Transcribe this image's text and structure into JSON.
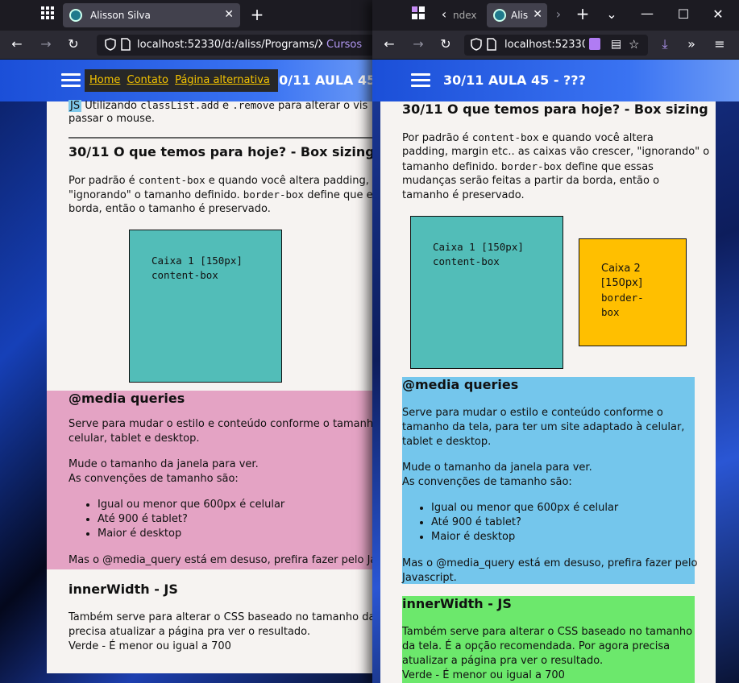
{
  "left": {
    "tab_title": "Alisson Silva",
    "url": "localhost:52330/d:/aliss/Programs/X",
    "url_extra": "Cursos",
    "nav": [
      "Home",
      "Contato",
      "Página alternativa"
    ],
    "header_title": "30/11 AULA 45 -",
    "intro_badge": "JS",
    "intro_text_a": "Utilizando",
    "intro_code_a": "classList.add",
    "intro_text_b": "e",
    "intro_code_b": ".remove",
    "intro_text_c": "para alterar o vis",
    "intro_line2": "passar o mouse.",
    "box_title": "30/11 O que temos para hoje? - Box sizing",
    "box_p1_a": "Por padrão é",
    "box_p1_code": "content-box",
    "box_p1_b": "e quando você altera padding, n",
    "box_p2_a": "\"ignorando\" o tamanho definido.",
    "box_p2_code": "border-box",
    "box_p2_b": "define que es",
    "box_p3": "borda, então o tamanho é preservado.",
    "caixa1_label": "Caixa 1 [150px]",
    "caixa1_code": "content-box",
    "media_title": "@media queries",
    "media_p1a": "Serve para mudar o estilo e conteúdo conforme o tamanho d",
    "media_p1b": "celular, tablet e desktop.",
    "media_p2": "Mude o tamanho da janela para ver.",
    "media_p3": "As convenções de tamanho são:",
    "media_list": [
      "Igual ou menor que 600px é celular",
      "Até 900 é tablet?",
      "Maior é desktop"
    ],
    "media_p4": "Mas o @media_query está em desuso, prefira fazer pelo Java",
    "inner_title": "innerWidth - JS",
    "inner_p1": "Também serve para alterar o CSS baseado no tamanho da te",
    "inner_p2": "precisa atualizar a página pra ver o resultado.",
    "inner_p3": "Verde - É menor ou igual a 700"
  },
  "right": {
    "tab_title_1": "ndex",
    "tab_title_2": "Alis",
    "url": "localhost:52330",
    "header_title": "30/11 AULA 45 - ???",
    "box_title": "30/11 O que temos para hoje? - Box sizing",
    "box_p1_a": "Por padrão é",
    "box_p1_code": "content-box",
    "box_p1_b": "e quando você altera",
    "box_p2": "padding, margin etc.. as caixas vão crescer, \"ignorando\" o",
    "box_p3_a": "tamanho definido.",
    "box_p3_code": "border-box",
    "box_p3_b": "define que essas",
    "box_p4": "mudanças serão feitas a partir da borda, então o",
    "box_p5": "tamanho é preservado.",
    "caixa1_label": "Caixa 1 [150px]",
    "caixa1_code": "content-box",
    "caixa2_label_a": "Caixa 2",
    "caixa2_label_b": "[150px]",
    "caixa2_code_a": "border-",
    "caixa2_code_b": "box",
    "media_title": "@media queries",
    "media_p1a": "Serve para mudar o estilo e conteúdo conforme o",
    "media_p1b": "tamanho da tela, para ter um site adaptado à celular,",
    "media_p1c": "tablet e desktop.",
    "media_p2": "Mude o tamanho da janela para ver.",
    "media_p3": "As convenções de tamanho são:",
    "media_list": [
      "Igual ou menor que 600px é celular",
      "Até 900 é tablet?",
      "Maior é desktop"
    ],
    "media_p4a": "Mas o @media_query está em desuso, prefira fazer pelo",
    "media_p4b": "Javascript.",
    "inner_title": "innerWidth - JS",
    "inner_p1": "Também serve para alterar o CSS baseado no tamanho",
    "inner_p2": "da tela. É a opção recomendada. Por agora precisa",
    "inner_p3": "atualizar a página pra ver o resultado.",
    "inner_p4": "Verde - É menor ou igual a 700"
  },
  "colors": {
    "teal_box": "#52bdb8",
    "yellow_box": "#ffbf00",
    "pink_section": "#e4a3c4",
    "blue_section": "#74c6ec",
    "green_section": "#6ce86c",
    "nav_link": "#f5c400"
  },
  "icons": [
    "apps-grid-icon",
    "back-icon",
    "forward-icon",
    "reload-icon",
    "shield-icon",
    "page-icon",
    "close-icon",
    "new-tab-icon",
    "window-icon",
    "extensions-icon",
    "star-icon",
    "download-icon",
    "menu-icon",
    "minimize-icon",
    "maximize-icon",
    "hamburger-icon"
  ]
}
